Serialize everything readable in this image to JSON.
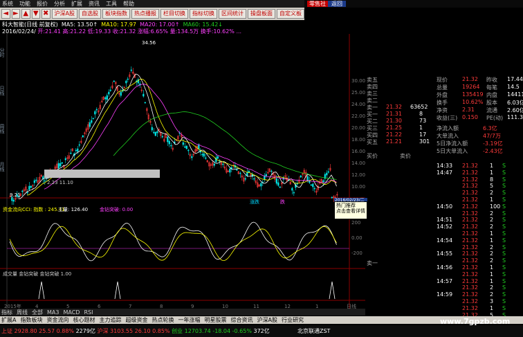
{
  "menu": [
    "系统",
    "功能",
    "报价",
    "分析",
    "扩展",
    "资讯",
    "工具",
    "帮助"
  ],
  "brand": {
    "badge": "零售社",
    "back": "返回"
  },
  "toolbar": {
    "arrows": [
      "◄",
      "►",
      "▲",
      "▼",
      "✖"
    ],
    "buttons": [
      "沪深A股",
      "自选股",
      "板块指数",
      "热点播报",
      "栏目切换",
      "指标切换",
      "区间统计",
      "操盘板面",
      "自定义板"
    ]
  },
  "info1": {
    "stock": "科大智能(日线 前复权)",
    "ma5": "MA5: 13.50↑",
    "ma10": "MA10: 17.97",
    "ma20": "MA20: 17.00↑",
    "ma60": "MA60: 15.42↓"
  },
  "info2": {
    "date": "2016/02/24/",
    "rest": "开:21.41 高:21.22 低:19.33 收:21.32 涨幅:6.65%  量:134.5万  换手:10.62%  ..."
  },
  "chart_axis": {
    "right_ticks": [
      "30.00",
      "25.00",
      "24.00",
      "22.00",
      "20.00",
      "18.00",
      "16.00",
      "14.00",
      "12.00",
      "10.00"
    ],
    "peak_label": "34.56",
    "low_label": "9.21",
    "range_label": "2.23  11.10"
  },
  "middle_labels": {
    "left": "涨跌",
    "right": "跌"
  },
  "indicator": {
    "cci": "资金流向CCI: 指数 : 245.41",
    "vol": "主量: 126.40",
    "flow": "金钻突破: 0.00",
    "row2": "成交量  金钻突破  金钻突破  1.00",
    "ticks": [
      "200",
      "0.00",
      "-200"
    ]
  },
  "tooltip": {
    "date": "2016/02/23/二",
    "line1": "热门推荐",
    "line2": "点击查看详情"
  },
  "bottom_tabs": [
    "指标",
    "周线",
    "全部",
    "MA3",
    "MACD",
    "RSI"
  ],
  "time_labels": [
    "2015年",
    "4",
    "5",
    "6",
    "7",
    "8",
    "9",
    "10",
    "11",
    "12",
    "1",
    "日线"
  ],
  "bottom_nav": [
    "扩展A",
    "指数板块",
    "资金流向",
    "核心题材",
    "主力追踪",
    "超级资金",
    "热点轮换",
    "一年涨幅",
    "明星股票",
    "综合资讯",
    "沪深A股",
    "行业研究"
  ],
  "status": {
    "sh": "上证 2928.80  25.57  0.88%",
    "sh_amt": "2279亿",
    "sz": "沪深 3103.55  26.10  0.85%",
    "cy": "创业 12703.74  -18.04  -0.65%",
    "amt2": "372亿",
    "right": "北京联通ZST"
  },
  "watermark": "www.7gpzb.com",
  "orderbook": {
    "sell": [
      {
        "label": "卖五",
        "price": "",
        "vol": ""
      },
      {
        "label": "卖四",
        "price": "",
        "vol": ""
      },
      {
        "label": "卖三",
        "price": "",
        "vol": ""
      },
      {
        "label": "卖二",
        "price": "",
        "vol": ""
      },
      {
        "label": "卖一",
        "price": "21.32",
        "vol": "63652"
      }
    ],
    "buy": [
      {
        "label": "买一",
        "price": "21.31",
        "vol": "8"
      },
      {
        "label": "买二",
        "price": "21.30",
        "vol": "73"
      },
      {
        "label": "买三",
        "price": "21.25",
        "vol": "1"
      },
      {
        "label": "买四",
        "price": "21.22",
        "vol": "17"
      },
      {
        "label": "买五",
        "price": "21.21",
        "vol": "301"
      }
    ]
  },
  "quote": {
    "rows": [
      {
        "l1": "现价",
        "v1": "21.32",
        "l2": "昨收",
        "v2": "17.44"
      },
      {
        "l1": "总量",
        "v1": "19264",
        "l2": "每笔",
        "v2": "14.5"
      },
      {
        "l1": "外盘",
        "v1": "135419",
        "l2": "内盘",
        "v2": "144118"
      },
      {
        "l1": "换手",
        "v1": "10.62%",
        "l2": "股本",
        "v2": "6.03亿"
      },
      {
        "l1": "净资",
        "v1": "2.31",
        "l2": "流通",
        "v2": "2.60亿"
      },
      {
        "l1": "收益(三)",
        "v1": "0.150",
        "l2": "PE(动)",
        "v2": "111.3"
      }
    ],
    "flow": [
      {
        "label": "净流入额",
        "value": "6.3亿"
      },
      {
        "label": "大单流入",
        "value": "47/7万"
      },
      {
        "label": "5日净流入额",
        "value": "-3.19亿"
      },
      {
        "label": "5日大单流入",
        "value": "-2.43亿"
      }
    ]
  },
  "trades": [
    {
      "time": "14:33",
      "price": "21.32",
      "vol": "1",
      "dir": "S"
    },
    {
      "time": "14:47",
      "price": "21.32",
      "vol": "1",
      "dir": "S"
    },
    {
      "time": "",
      "price": "21.32",
      "vol": "8",
      "dir": "S"
    },
    {
      "time": "",
      "price": "21.32",
      "vol": "5",
      "dir": "S"
    },
    {
      "time": "",
      "price": "21.32",
      "vol": "2",
      "dir": "S"
    },
    {
      "time": "",
      "price": "21.32",
      "vol": "1",
      "dir": "S"
    },
    {
      "time": "14:50",
      "price": "21.32",
      "vol": "100",
      "dir": "S"
    },
    {
      "time": "",
      "price": "21.32",
      "vol": "2",
      "dir": "S"
    },
    {
      "time": "14:51",
      "price": "21.32",
      "vol": "2",
      "dir": "S"
    },
    {
      "time": "14:52",
      "price": "21.32",
      "vol": "2",
      "dir": "S"
    },
    {
      "time": "",
      "price": "21.32",
      "vol": "1",
      "dir": "S"
    },
    {
      "time": "14:54",
      "price": "21.32",
      "vol": "1",
      "dir": "S"
    },
    {
      "time": "",
      "price": "21.32",
      "vol": "2",
      "dir": "S"
    },
    {
      "time": "14:55",
      "price": "21.32",
      "vol": "2",
      "dir": "S"
    },
    {
      "time": "",
      "price": "21.32",
      "vol": "2",
      "dir": "S"
    },
    {
      "time": "14:56",
      "price": "21.32",
      "vol": "1",
      "dir": "S"
    },
    {
      "time": "",
      "price": "21.32",
      "vol": "1",
      "dir": "S"
    },
    {
      "time": "14:57",
      "price": "21.32",
      "vol": "1",
      "dir": "S"
    },
    {
      "time": "",
      "price": "21.32",
      "vol": "2",
      "dir": "S"
    },
    {
      "time": "14:59",
      "price": "21.32",
      "vol": "2",
      "dir": "S"
    },
    {
      "time": "",
      "price": "21.32",
      "vol": "3",
      "dir": "S"
    },
    {
      "time": "",
      "price": "21.32",
      "vol": "1",
      "dir": "S"
    },
    {
      "time": "",
      "price": "21.32",
      "vol": "5",
      "dir": "S"
    }
  ],
  "side_panel": {
    "top": "买一",
    "mid": "卖一"
  },
  "side_tabs": [
    "买价",
    "卖价"
  ],
  "colors": {
    "up": "#ff3b3b",
    "down": "#00e5e5",
    "ma5": "#ffffff",
    "ma10": "#ffff00",
    "ma20": "#ff40ff",
    "ma60": "#20d020"
  }
}
